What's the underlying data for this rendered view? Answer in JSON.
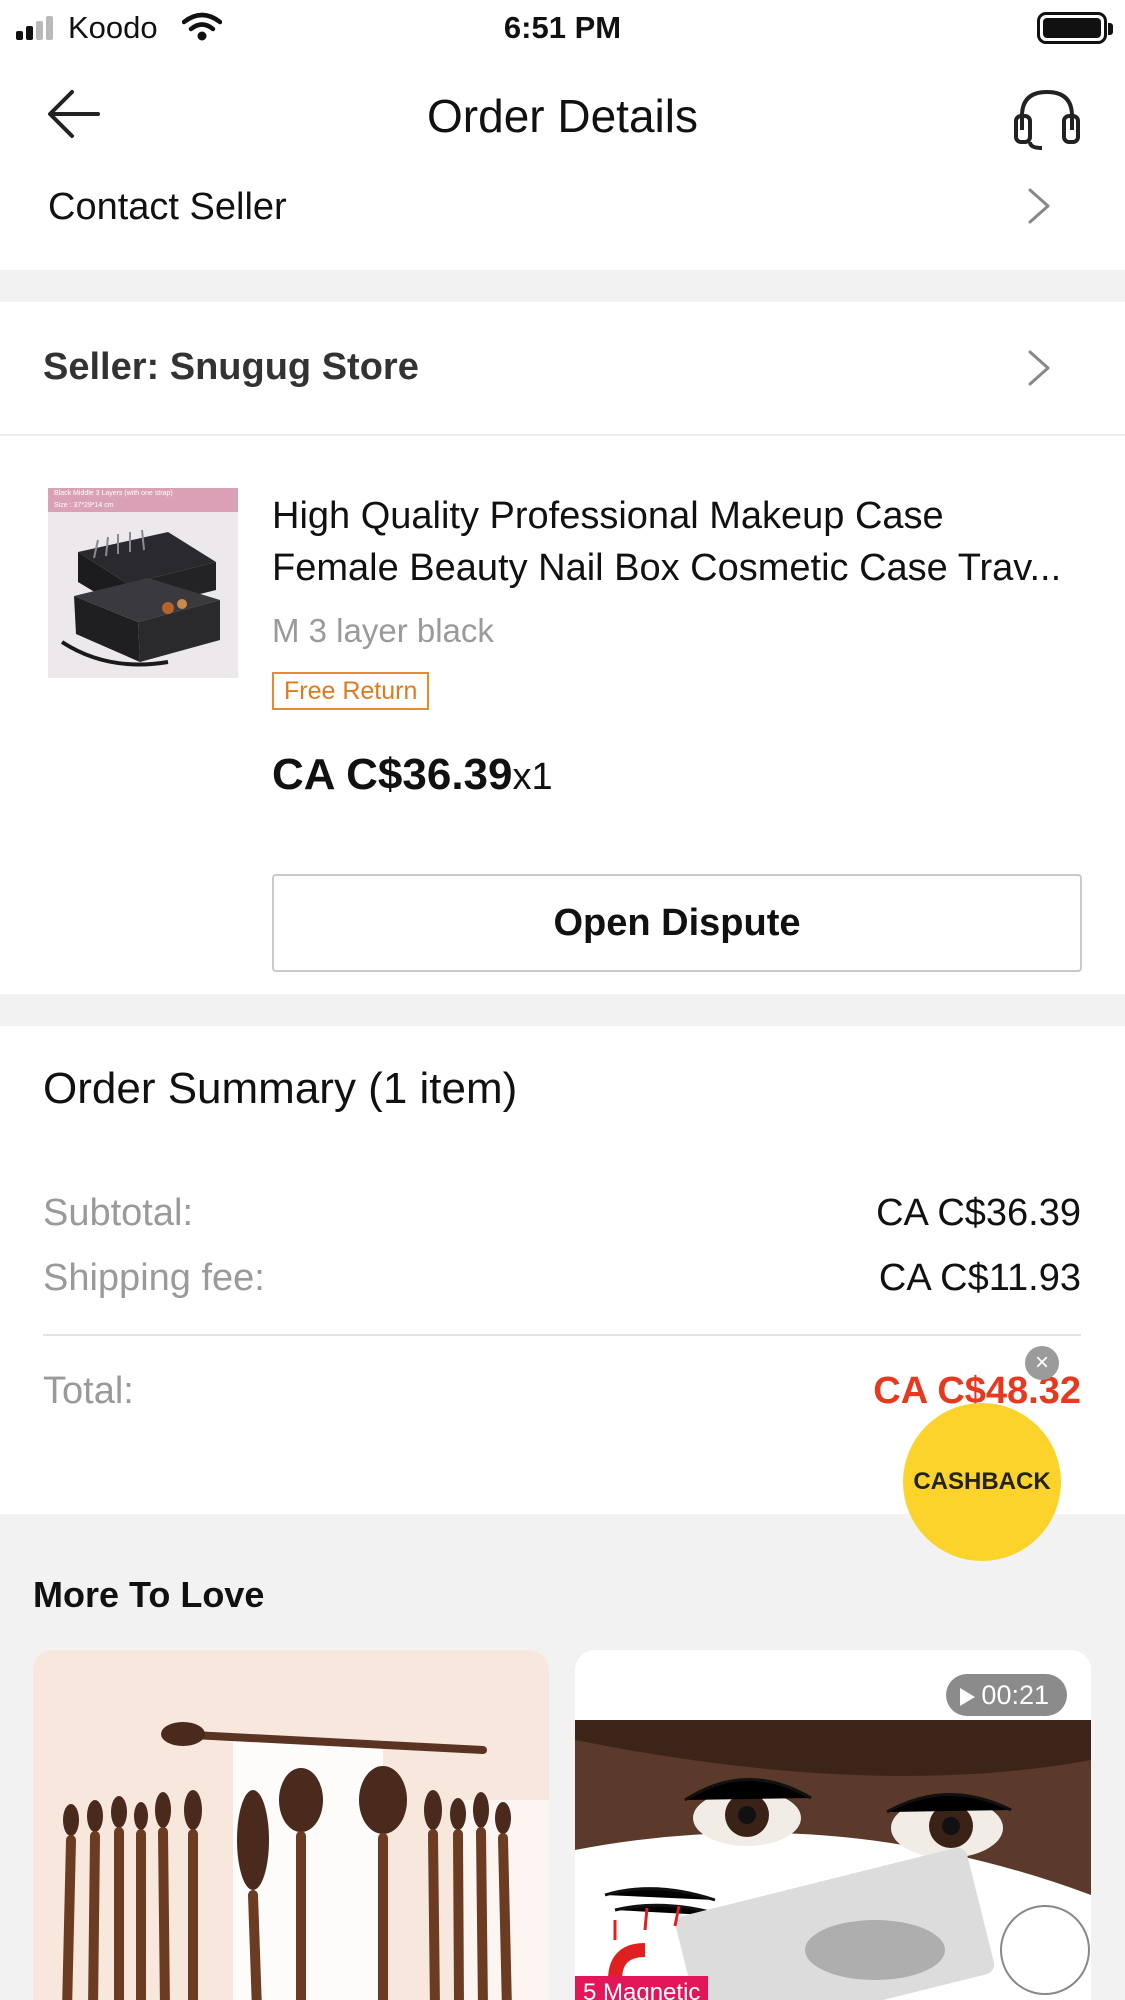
{
  "status_bar": {
    "carrier": "Koodo",
    "time": "6:51 PM"
  },
  "header": {
    "title": "Order Details"
  },
  "contact_seller": {
    "label": "Contact Seller"
  },
  "seller": {
    "label": "Seller: Snugug Store"
  },
  "product": {
    "title_line1": "High Quality Professional Makeup Case",
    "title_line2": "Female Beauty Nail Box Cosmetic Case Trav...",
    "variant": "M 3 layer black",
    "badge": "Free Return",
    "price": "CA C$36.39",
    "quantity": "x1",
    "image_caption": "Black Middle 3 Layers (with one strap)",
    "image_size_text": "Size : 37*29*14 cm"
  },
  "actions": {
    "open_dispute": "Open Dispute"
  },
  "summary": {
    "title": "Order Summary (1 item)",
    "subtotal_label": "Subtotal:",
    "subtotal_value": "CA C$36.39",
    "shipping_label": "Shipping fee:",
    "shipping_value": "CA C$11.93",
    "total_label": "Total:",
    "total_value": "CA C$48.32"
  },
  "cashback": {
    "label": "CASHBACK"
  },
  "more_to_love": {
    "title": "More To Love",
    "items": [
      {
        "name": "makeup brush set"
      },
      {
        "video_duration": "00:21",
        "tag": "5 Magnetic"
      }
    ]
  },
  "colors": {
    "accent_red": "#e8391f",
    "badge_orange": "#e07a1e",
    "cashback_yellow": "#fbd32a",
    "section_gray": "#f2f2f2"
  },
  "icons": [
    "back-arrow-icon",
    "headset-icon",
    "chevron-right-icon",
    "close-icon",
    "play-icon",
    "wifi-icon",
    "signal-icon",
    "battery-icon"
  ]
}
